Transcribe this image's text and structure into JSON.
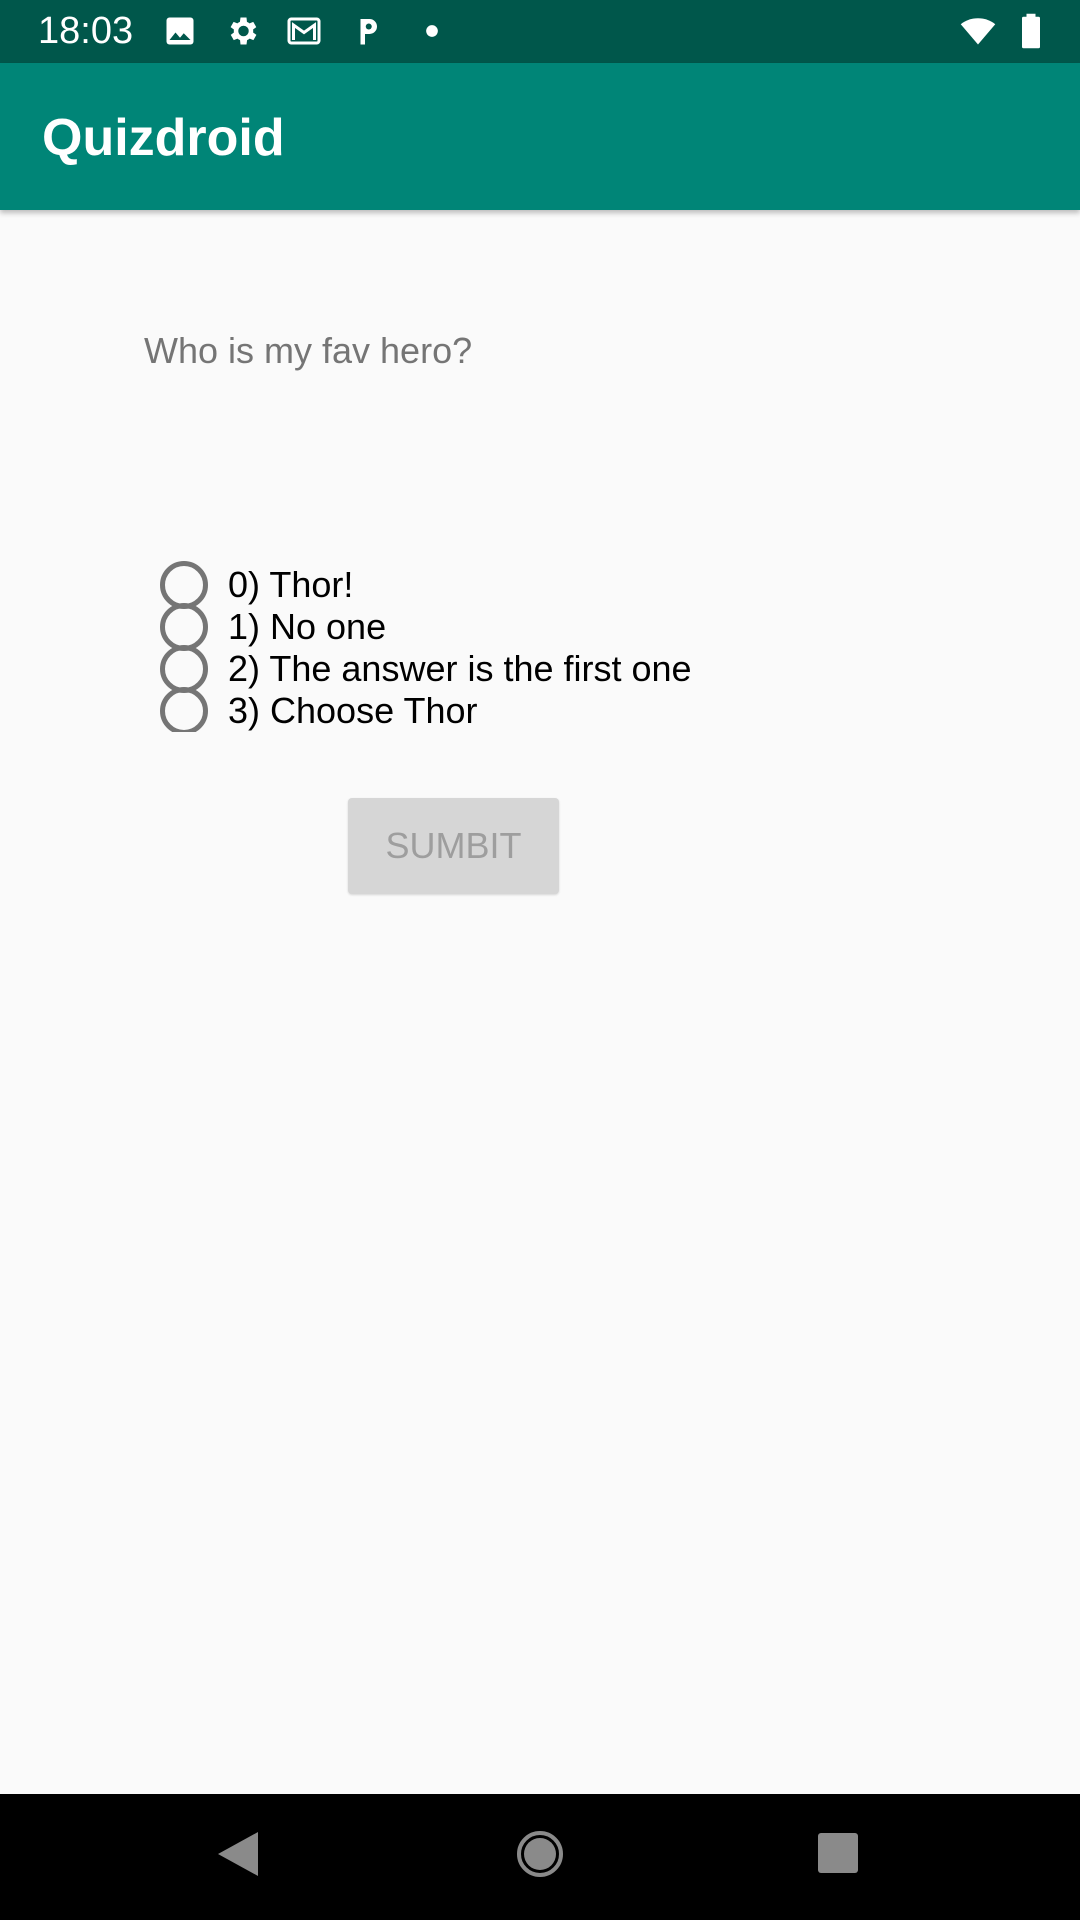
{
  "status_bar": {
    "time": "18:03",
    "icons": [
      "image-icon",
      "gear-icon",
      "gmail-icon",
      "parking-icon",
      "dot-icon",
      "wifi-icon",
      "battery-icon"
    ]
  },
  "app_bar": {
    "title": "Quizdroid"
  },
  "question": {
    "text": "Who is my fav hero?"
  },
  "options": [
    {
      "label": "0) Thor!",
      "selected": false
    },
    {
      "label": "1) No one",
      "selected": false
    },
    {
      "label": "2) The answer is the first one",
      "selected": false
    },
    {
      "label": "3) Choose Thor",
      "selected": false
    }
  ],
  "submit": {
    "label": "SUMBIT",
    "enabled": false
  },
  "nav_bar": {
    "buttons": [
      "back-icon",
      "home-icon",
      "recents-icon"
    ]
  },
  "colors": {
    "status_bar": "#00574b",
    "app_bar": "#008577",
    "background": "#fafafa",
    "button_disabled": "#d6d6d6"
  }
}
